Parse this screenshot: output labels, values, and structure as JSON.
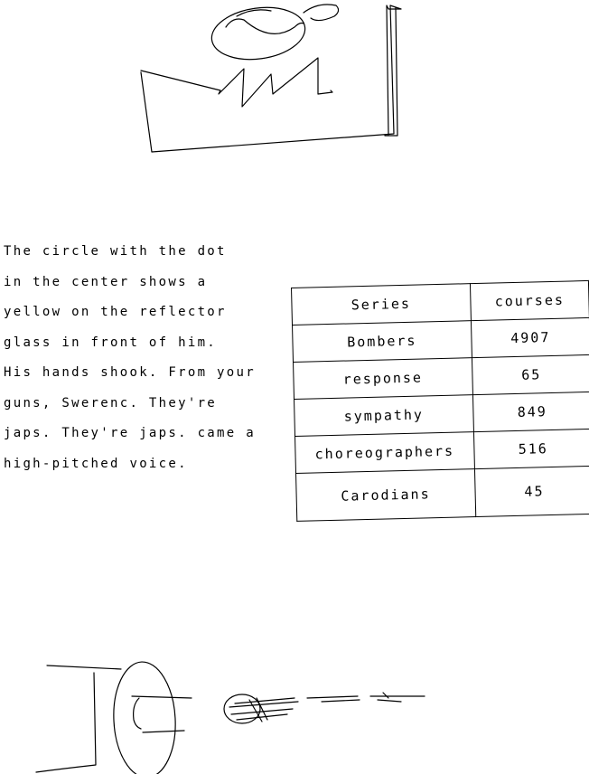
{
  "note": {
    "lines": [
      "The circle with the dot",
      "in the center shows a",
      "yellow on the reflector",
      "glass in front of him.",
      "His hands shook. From your",
      "guns, Swerenc. They're",
      "japs. They're japs. came a",
      "high-pitched voice."
    ]
  },
  "table": {
    "headers": [
      "Series",
      "courses"
    ],
    "rows": [
      [
        "Bombers",
        "4907"
      ],
      [
        "response",
        "65"
      ],
      [
        "sympathy",
        "849"
      ],
      [
        "choreographers",
        "516"
      ],
      [
        "Carodians",
        "45"
      ]
    ]
  },
  "sketches": {
    "top": "factory-roof-sketch",
    "bottom": "figure-and-scribble-sketch"
  }
}
